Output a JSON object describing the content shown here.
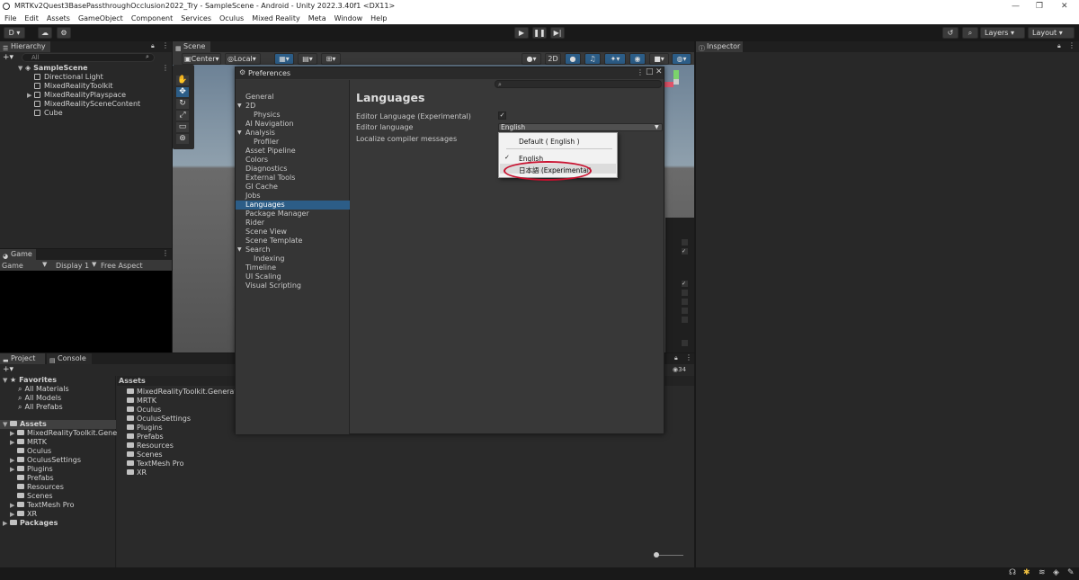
{
  "window": {
    "title": "MRTKv2Quest3BasePassthroughOcclusion2022_Try - SampleScene - Android - Unity 2022.3.40f1 <DX11>",
    "controls": [
      "—",
      "❐",
      "✕"
    ]
  },
  "menu": [
    "File",
    "Edit",
    "Assets",
    "GameObject",
    "Component",
    "Services",
    "Oculus",
    "Mixed Reality",
    "Meta",
    "Window",
    "Help"
  ],
  "toolbar": {
    "account": "D ▾",
    "layers": "Layers",
    "layout": "Layout"
  },
  "hierarchy": {
    "tab": "Hierarchy",
    "search_placeholder": "All",
    "scene": "SampleScene",
    "items": [
      "Directional Light",
      "MixedRealityToolkit",
      "MixedRealityPlayspace",
      "MixedRealitySceneContent",
      "Cube"
    ]
  },
  "scene": {
    "tab": "Scene",
    "pivot": "Center",
    "space": "Local",
    "mode_2d": "2D"
  },
  "game": {
    "tab": "Game",
    "mode": "Game",
    "display": "Display 1",
    "aspect": "Free Aspect"
  },
  "inspector": {
    "tab": "Inspector"
  },
  "project": {
    "tab_project": "Project",
    "tab_console": "Console",
    "hidden_count": "34",
    "favorites": "Favorites",
    "favorites_items": [
      "All Materials",
      "All Models",
      "All Prefabs"
    ],
    "assets": "Assets",
    "asset_folders": [
      "MixedRealityToolkit.Generated",
      "MRTK",
      "Oculus",
      "OculusSettings",
      "Plugins",
      "Prefabs",
      "Resources",
      "Scenes",
      "TextMesh Pro",
      "XR"
    ],
    "packages": "Packages",
    "breadcrumb": "Assets",
    "content_items": [
      "MixedRealityToolkit.Generated",
      "MRTK",
      "Oculus",
      "OculusSettings",
      "Plugins",
      "Prefabs",
      "Resources",
      "Scenes",
      "TextMesh Pro",
      "XR"
    ]
  },
  "preferences": {
    "title": "Preferences",
    "categories": [
      {
        "label": "General",
        "indent": 0,
        "arrow": ""
      },
      {
        "label": "2D",
        "indent": 0,
        "arrow": "▼"
      },
      {
        "label": "Physics",
        "indent": 1,
        "arrow": ""
      },
      {
        "label": "AI Navigation",
        "indent": 0,
        "arrow": ""
      },
      {
        "label": "Analysis",
        "indent": 0,
        "arrow": "▼"
      },
      {
        "label": "Profiler",
        "indent": 1,
        "arrow": ""
      },
      {
        "label": "Asset Pipeline",
        "indent": 0,
        "arrow": ""
      },
      {
        "label": "Colors",
        "indent": 0,
        "arrow": ""
      },
      {
        "label": "Diagnostics",
        "indent": 0,
        "arrow": ""
      },
      {
        "label": "External Tools",
        "indent": 0,
        "arrow": ""
      },
      {
        "label": "GI Cache",
        "indent": 0,
        "arrow": ""
      },
      {
        "label": "Jobs",
        "indent": 0,
        "arrow": ""
      },
      {
        "label": "Languages",
        "indent": 0,
        "arrow": ""
      },
      {
        "label": "Package Manager",
        "indent": 0,
        "arrow": ""
      },
      {
        "label": "Rider",
        "indent": 0,
        "arrow": ""
      },
      {
        "label": "Scene View",
        "indent": 0,
        "arrow": ""
      },
      {
        "label": "Scene Template",
        "indent": 0,
        "arrow": ""
      },
      {
        "label": "Search",
        "indent": 0,
        "arrow": "▼"
      },
      {
        "label": "Indexing",
        "indent": 1,
        "arrow": ""
      },
      {
        "label": "Timeline",
        "indent": 0,
        "arrow": ""
      },
      {
        "label": "UI Scaling",
        "indent": 0,
        "arrow": ""
      },
      {
        "label": "Visual Scripting",
        "indent": 0,
        "arrow": ""
      }
    ],
    "selected": "Languages",
    "heading": "Languages",
    "fields": {
      "editor_language_experimental": "Editor Language (Experimental)",
      "editor_language": "Editor language",
      "editor_language_value": "English",
      "localize_compiler": "Localize compiler messages"
    },
    "dropdown": {
      "options": [
        "Default ( English )",
        "English",
        "日本語 (Experimental)"
      ],
      "checked": "English",
      "highlighted": "日本語 (Experimental)",
      "highlight_ring_color": "#c8102e"
    }
  },
  "colors": {
    "selection": "#2c5d87",
    "panel": "#282828",
    "dialog": "#383838"
  }
}
